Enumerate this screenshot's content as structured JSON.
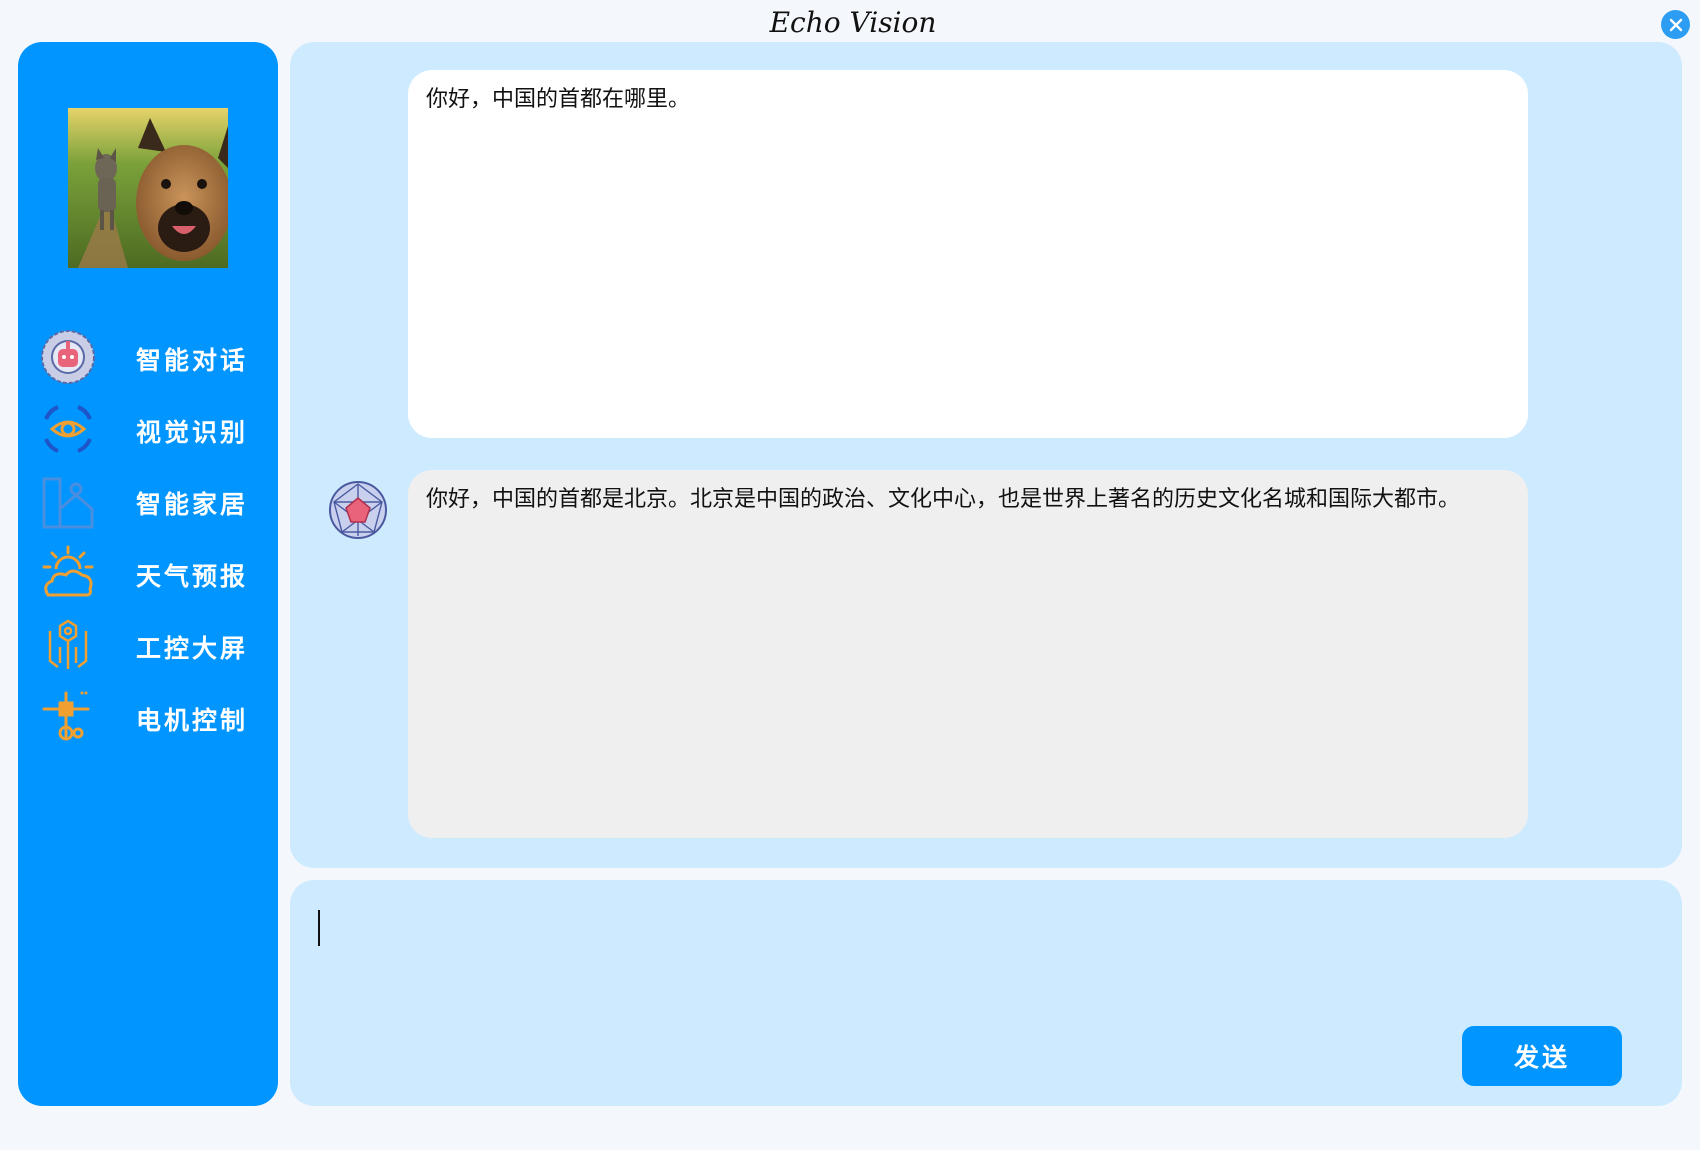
{
  "window": {
    "title": "Echo Vision",
    "close_icon": "close-icon"
  },
  "sidebar": {
    "avatar_icon": "dog-wolf-photo",
    "items": [
      {
        "label": "智能对话",
        "icon": "chat-robot-icon"
      },
      {
        "label": "视觉识别",
        "icon": "eye-scan-icon"
      },
      {
        "label": "智能家居",
        "icon": "smart-home-icon"
      },
      {
        "label": "天气预报",
        "icon": "weather-icon"
      },
      {
        "label": "工控大屏",
        "icon": "industrial-control-icon"
      },
      {
        "label": "电机控制",
        "icon": "motor-control-icon"
      }
    ]
  },
  "chat": {
    "messages": [
      {
        "role": "user",
        "text": "你好，中国的首都在哪里。"
      },
      {
        "role": "assistant",
        "text": "你好，中国的首都是北京。北京是中国的政治、文化中心，也是世界上著名的历史文化名城和国际大都市。",
        "avatar_icon": "crystal-avatar-icon"
      }
    ]
  },
  "input": {
    "value": "",
    "send_label": "发送"
  },
  "colors": {
    "sidebar": "#0095ff",
    "panel": "#cdeaff",
    "user_bubble": "#ffffff",
    "bot_bubble": "#efefef",
    "accent_icon": "#f0a030"
  }
}
